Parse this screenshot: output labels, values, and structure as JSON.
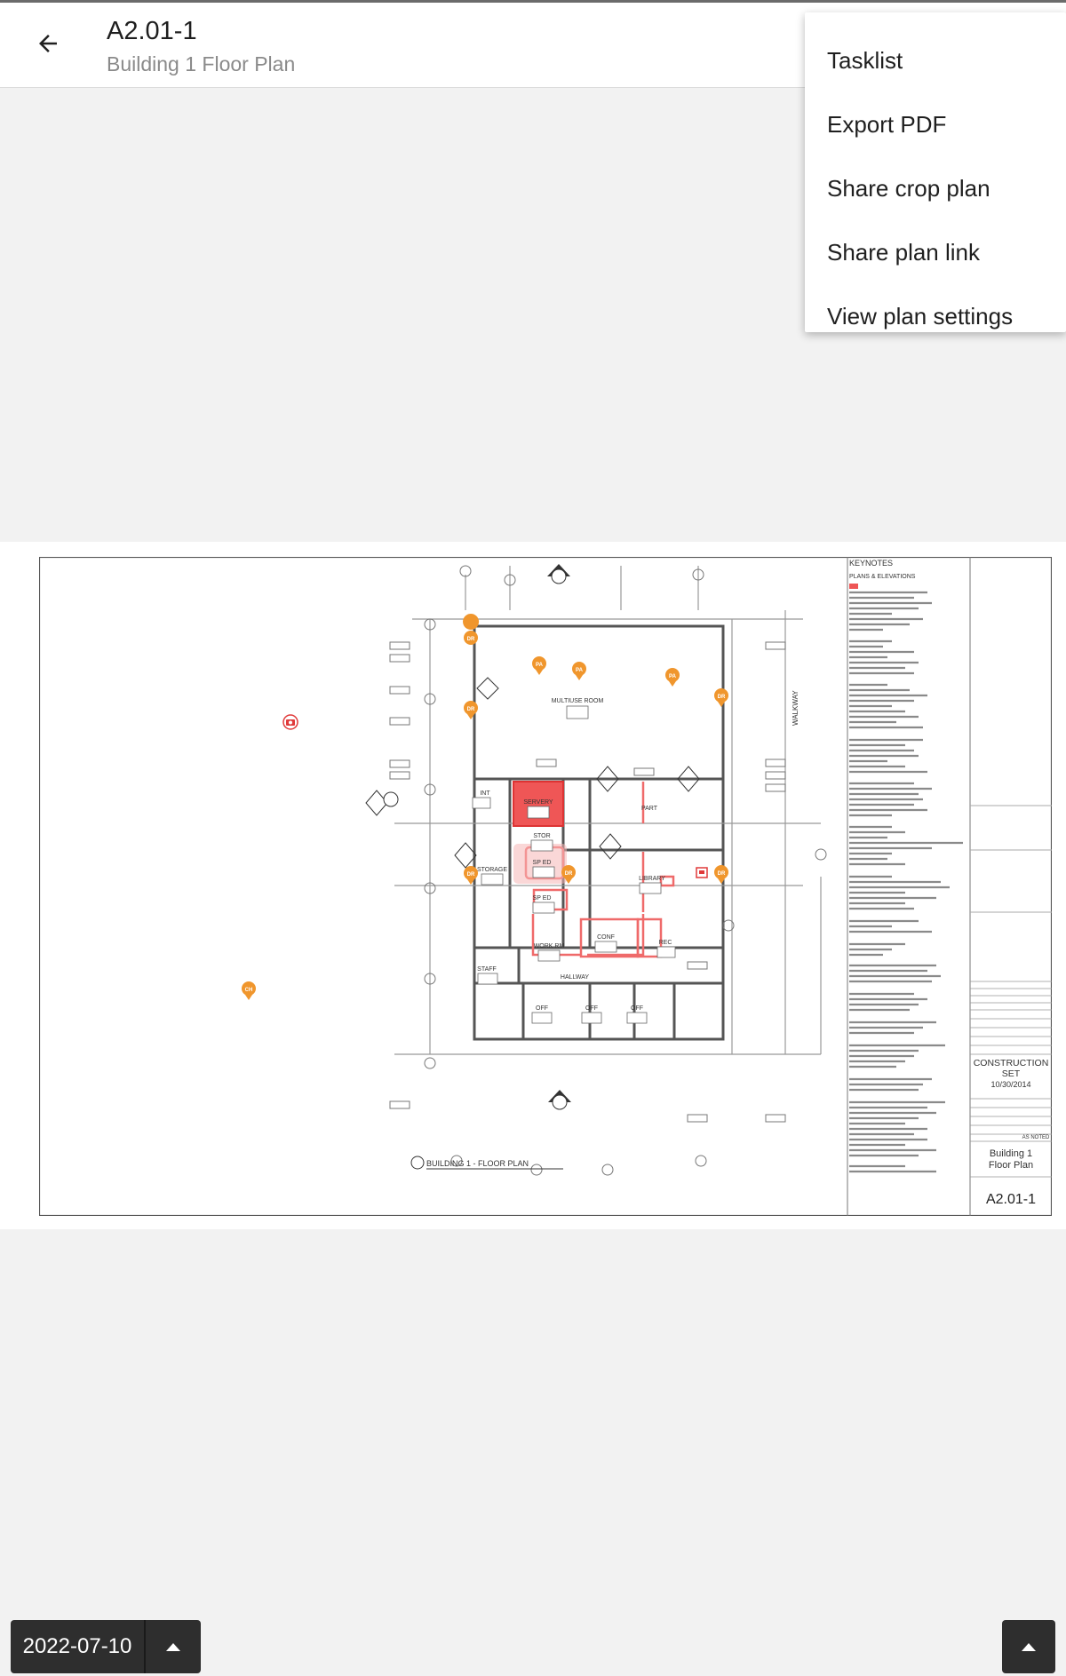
{
  "header": {
    "title": "A2.01-1",
    "subtitle": "Building 1 Floor Plan"
  },
  "menu": {
    "items": [
      {
        "label": "Tasklist"
      },
      {
        "label": "Export PDF"
      },
      {
        "label": "Share crop plan"
      },
      {
        "label": "Share plan link"
      },
      {
        "label": "View plan settings"
      }
    ]
  },
  "plan": {
    "rooms": {
      "multiuse": "MULTIUSE ROOM",
      "servery": "SERVERY",
      "stor": "STOR",
      "spied_1": "SP ED",
      "spied_2": "SP ED",
      "storage": "STORAGE",
      "library": "LIBRARY",
      "part": "PART",
      "work": "WORK RM",
      "conf": "CONF",
      "rec": "REC",
      "staff": "STAFF",
      "hallway": "HALLWAY",
      "off_1": "OFF",
      "off_2": "OFF",
      "off_3": "OFF",
      "int": "INT"
    },
    "walkway": "WALKWAY",
    "plan_caption": "BUILDING 1 - FLOOR PLAN",
    "pins": {
      "dr": "DR",
      "pa": "PA",
      "ch": "CH"
    },
    "keynotes": {
      "title": "KEYNOTES",
      "subtitle": "PLANS & ELEVATIONS"
    },
    "title_block": {
      "set_line_1": "CONSTRUCTION",
      "set_line_2": "SET",
      "set_date": "10/30/2014",
      "scale": "AS NOTED",
      "sheet_title_1": "Building 1",
      "sheet_title_2": "Floor Plan",
      "sheet_number": "A2.01-1"
    }
  },
  "footer": {
    "date": "2022-07-10"
  },
  "colors": {
    "accent_pin": "#f0962d",
    "markup_red": "#ee4444",
    "camera_pin": "#e03a3a"
  }
}
